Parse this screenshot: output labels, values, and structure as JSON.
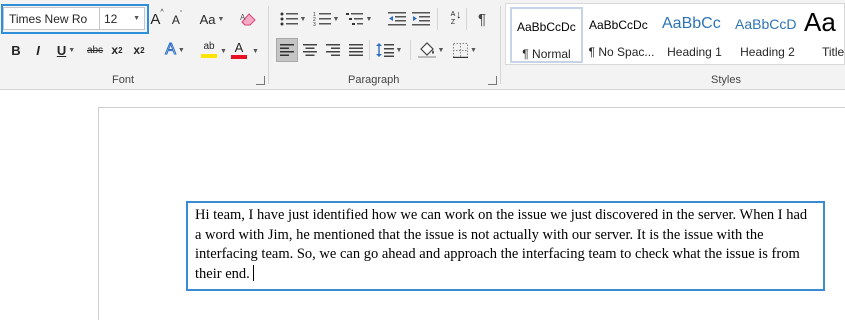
{
  "font": {
    "name": "Times New Ro",
    "size": "12",
    "grow_label": "A",
    "shrink_label": "A",
    "case_label": "Aa",
    "bold": "B",
    "italic": "I",
    "underline": "U",
    "strike": "abc",
    "subscript_base": "x",
    "subscript_mark": "2",
    "superscript_base": "x",
    "superscript_mark": "2",
    "effects_label": "A",
    "highlight_label": "ab",
    "color_label": "A",
    "group_label": "Font",
    "highlight_color": "#ffe400",
    "font_color": "#e81123",
    "effects_color": "#2b6cc4"
  },
  "paragraph": {
    "group_label": "Paragraph",
    "sort_label": "A Z",
    "show_marks": "¶"
  },
  "styles": {
    "group_label": "Styles",
    "items": [
      {
        "preview": "AaBbCcDc",
        "name": "¶ Normal",
        "color": "#000000"
      },
      {
        "preview": "AaBbCcDc",
        "name": "¶ No Spac...",
        "color": "#000000"
      },
      {
        "preview": "AaBbCc",
        "name": "Heading 1",
        "color": "#2e74b5"
      },
      {
        "preview": "AaBbCcD",
        "name": "Heading 2",
        "color": "#2e74b5"
      },
      {
        "preview": "Aa",
        "name": "Title",
        "color": "#000000"
      }
    ]
  },
  "document": {
    "text": "Hi team, I have just identified how we can work on the issue we just discovered in the server. When I had a word with Jim, he mentioned that the issue is not actually with our server. It is the issue with the interfacing team. So, we can go ahead and approach the interfacing team to check what the issue is from their end."
  },
  "colors": {
    "accent": "#2f8fd8",
    "selected_button": "#c5c5c5"
  }
}
